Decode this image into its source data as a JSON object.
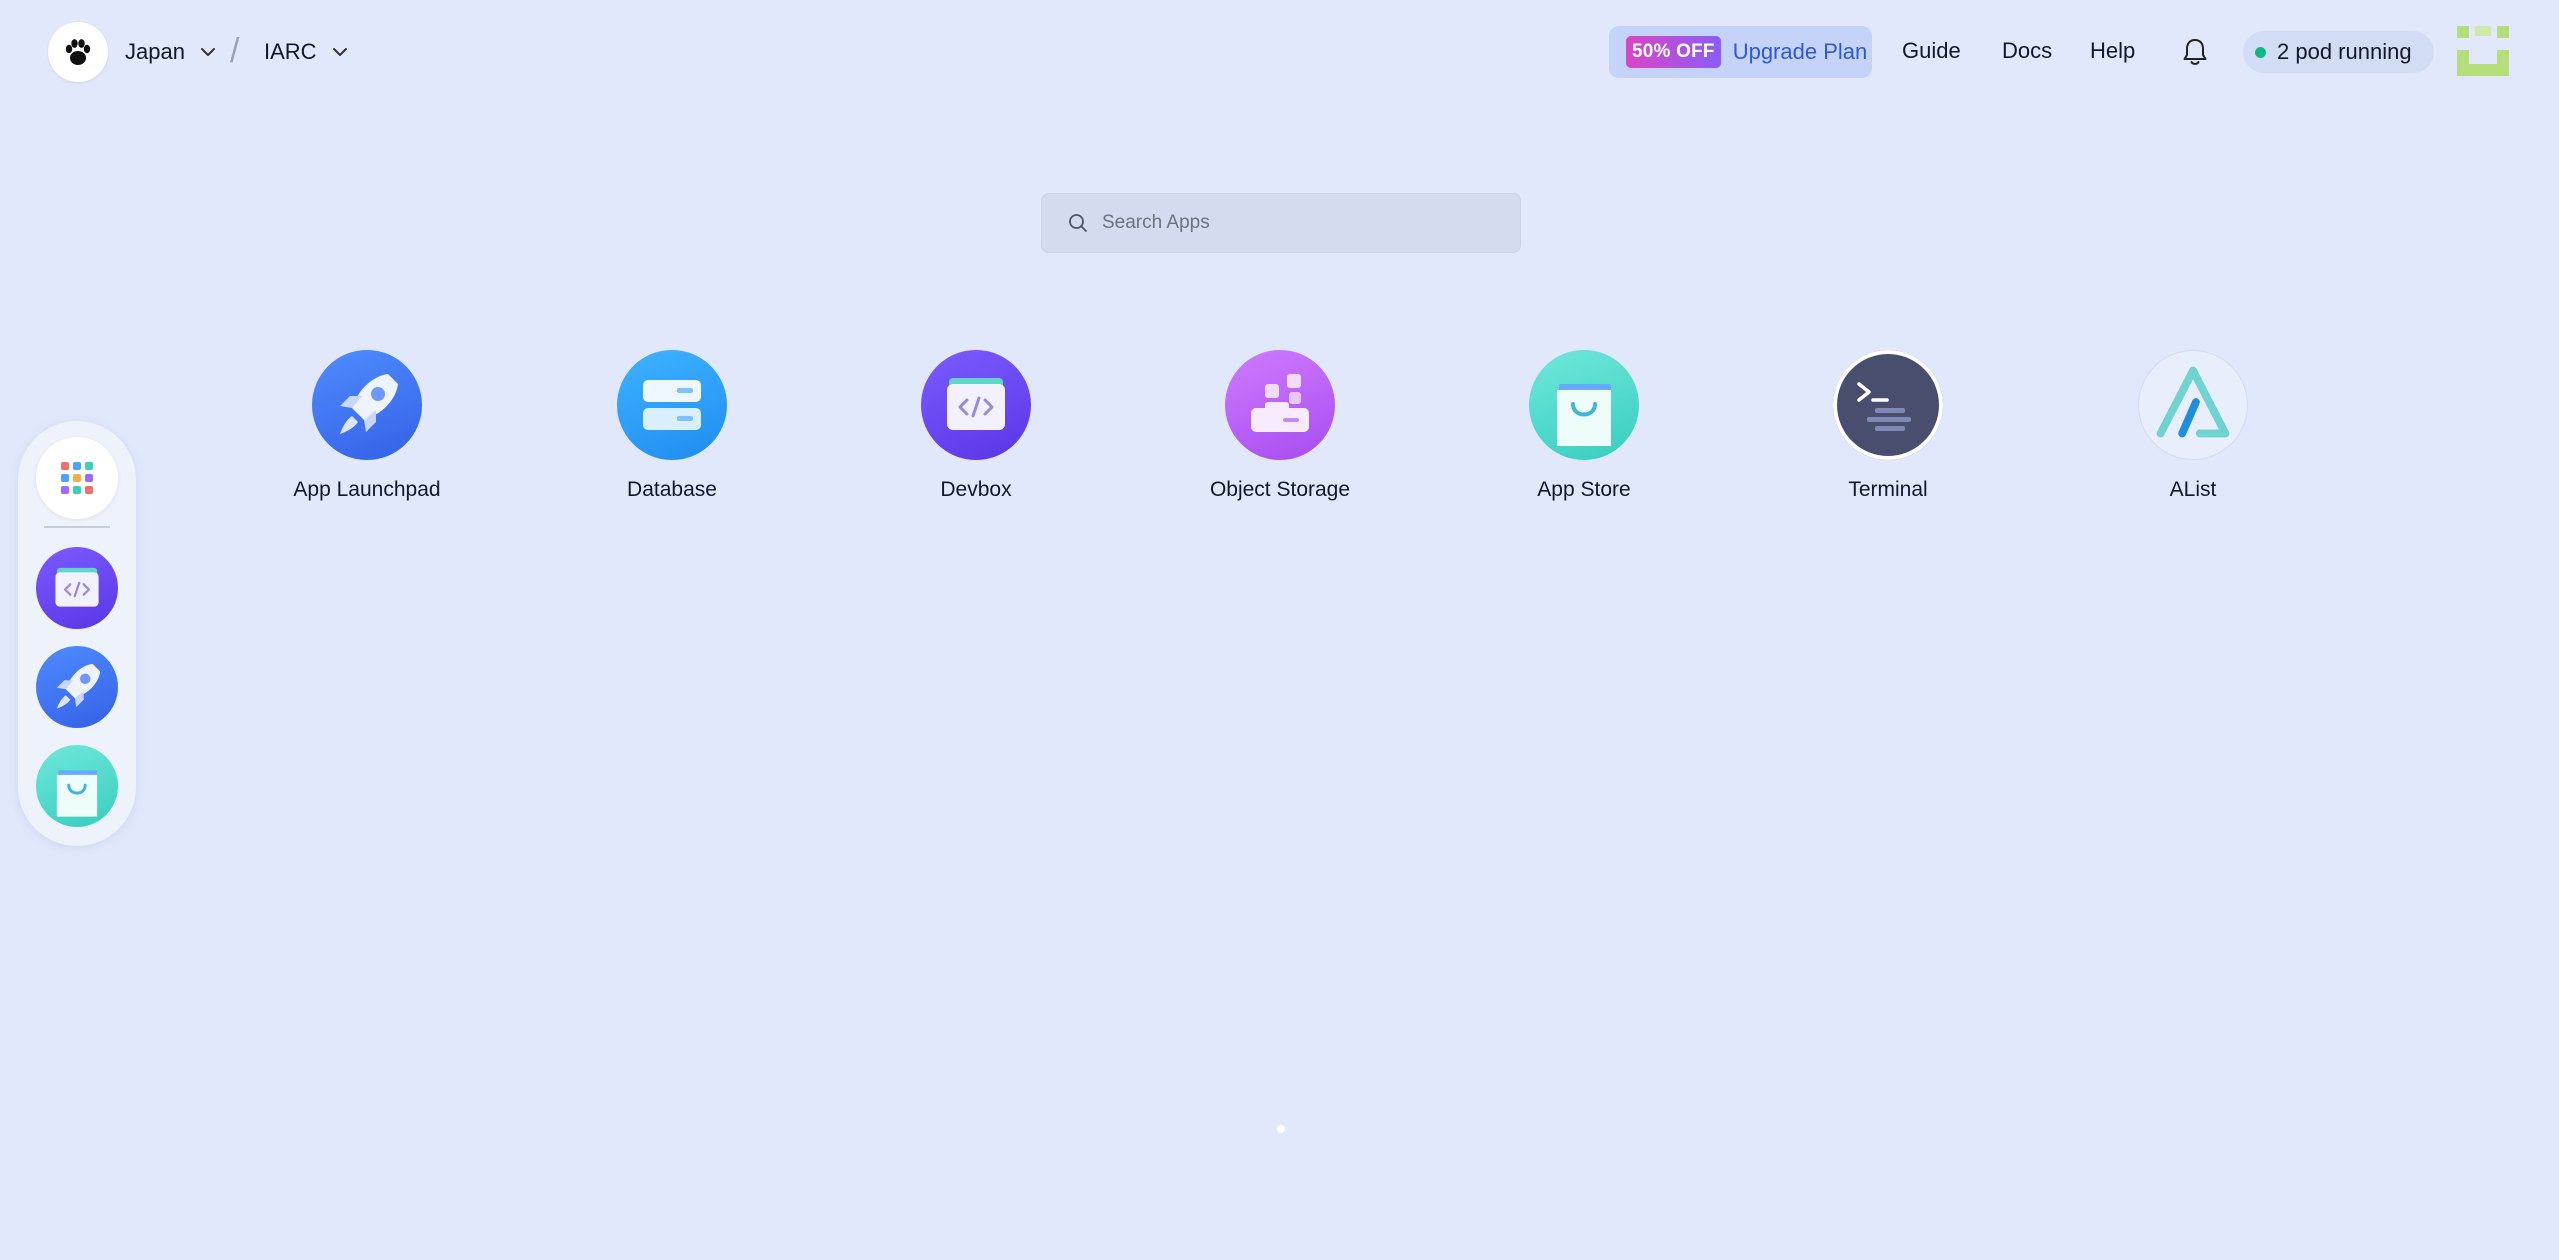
{
  "header": {
    "logo_icon": "paw-icon",
    "region": "Japan",
    "separator": "/",
    "workspace": "IARC",
    "upgrade": {
      "badge": "50% OFF",
      "label": "Upgrade Plan"
    },
    "links": [
      "Guide",
      "Docs",
      "Help"
    ],
    "notification_icon": "bell-icon",
    "pods_status": "2 pod running",
    "status_color": "#10b981"
  },
  "search": {
    "placeholder": "Search Apps",
    "value": ""
  },
  "apps": [
    {
      "label": "App Launchpad",
      "icon": "rocket-icon"
    },
    {
      "label": "Database",
      "icon": "database-icon"
    },
    {
      "label": "Devbox",
      "icon": "code-box-icon"
    },
    {
      "label": "Object Storage",
      "icon": "object-storage-icon"
    },
    {
      "label": "App Store",
      "icon": "shopping-bag-icon"
    },
    {
      "label": "Terminal",
      "icon": "terminal-icon"
    },
    {
      "label": "AList",
      "icon": "alist-icon"
    }
  ],
  "dock": {
    "items": [
      "apps-grid-icon",
      "code-box-icon",
      "rocket-icon",
      "shopping-bag-icon"
    ]
  },
  "pagination": {
    "current": 1,
    "total": 1
  },
  "colors": {
    "background": "#e1e8fb",
    "accent": "#2f58d6",
    "discount_gradient_start": "#d946c4",
    "discount_gradient_end": "#8b5cf6"
  }
}
